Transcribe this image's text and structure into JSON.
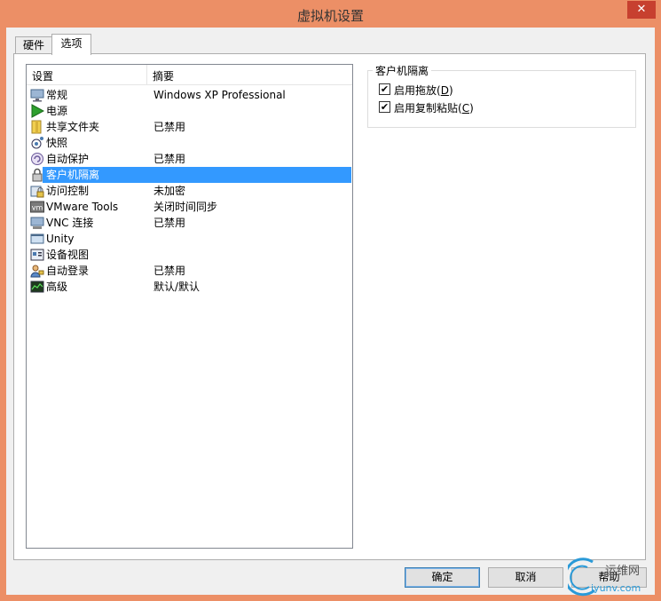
{
  "window": {
    "title": "虚拟机设置",
    "close_glyph": "✕"
  },
  "tabs": [
    {
      "label": "硬件"
    },
    {
      "label": "选项"
    }
  ],
  "list": {
    "headers": {
      "setting": "设置",
      "summary": "摘要"
    },
    "rows": [
      {
        "icon": "monitor-icon",
        "name": "常规",
        "summary": "Windows XP Professional"
      },
      {
        "icon": "power-icon",
        "name": "电源",
        "summary": ""
      },
      {
        "icon": "shared-folder-icon",
        "name": "共享文件夹",
        "summary": "已禁用"
      },
      {
        "icon": "snapshot-icon",
        "name": "快照",
        "summary": ""
      },
      {
        "icon": "autoprotect-icon",
        "name": "自动保护",
        "summary": "已禁用"
      },
      {
        "icon": "lock-icon",
        "name": "客户机隔离",
        "summary": ""
      },
      {
        "icon": "access-control-icon",
        "name": "访问控制",
        "summary": "未加密"
      },
      {
        "icon": "vmware-tools-icon",
        "name": "VMware Tools",
        "summary": "关闭时间同步"
      },
      {
        "icon": "vnc-icon",
        "name": "VNC 连接",
        "summary": "已禁用"
      },
      {
        "icon": "unity-icon",
        "name": "Unity",
        "summary": ""
      },
      {
        "icon": "device-view-icon",
        "name": "设备视图",
        "summary": ""
      },
      {
        "icon": "autologin-icon",
        "name": "自动登录",
        "summary": "已禁用"
      },
      {
        "icon": "advanced-icon",
        "name": "高级",
        "summary": "默认/默认"
      }
    ],
    "selected_index": 5
  },
  "isolation": {
    "group_title": "客户机隔离",
    "drag_drop": {
      "label": "启用拖放(",
      "key": "D",
      "suffix": ")",
      "checked": true
    },
    "copy_paste": {
      "label": "启用复制粘贴(",
      "key": "C",
      "suffix": ")",
      "checked": true
    }
  },
  "buttons": {
    "ok": "确定",
    "cancel": "取消",
    "help": "帮助"
  },
  "watermark": {
    "line1": "运维网",
    "line2": "iyunv.com"
  }
}
